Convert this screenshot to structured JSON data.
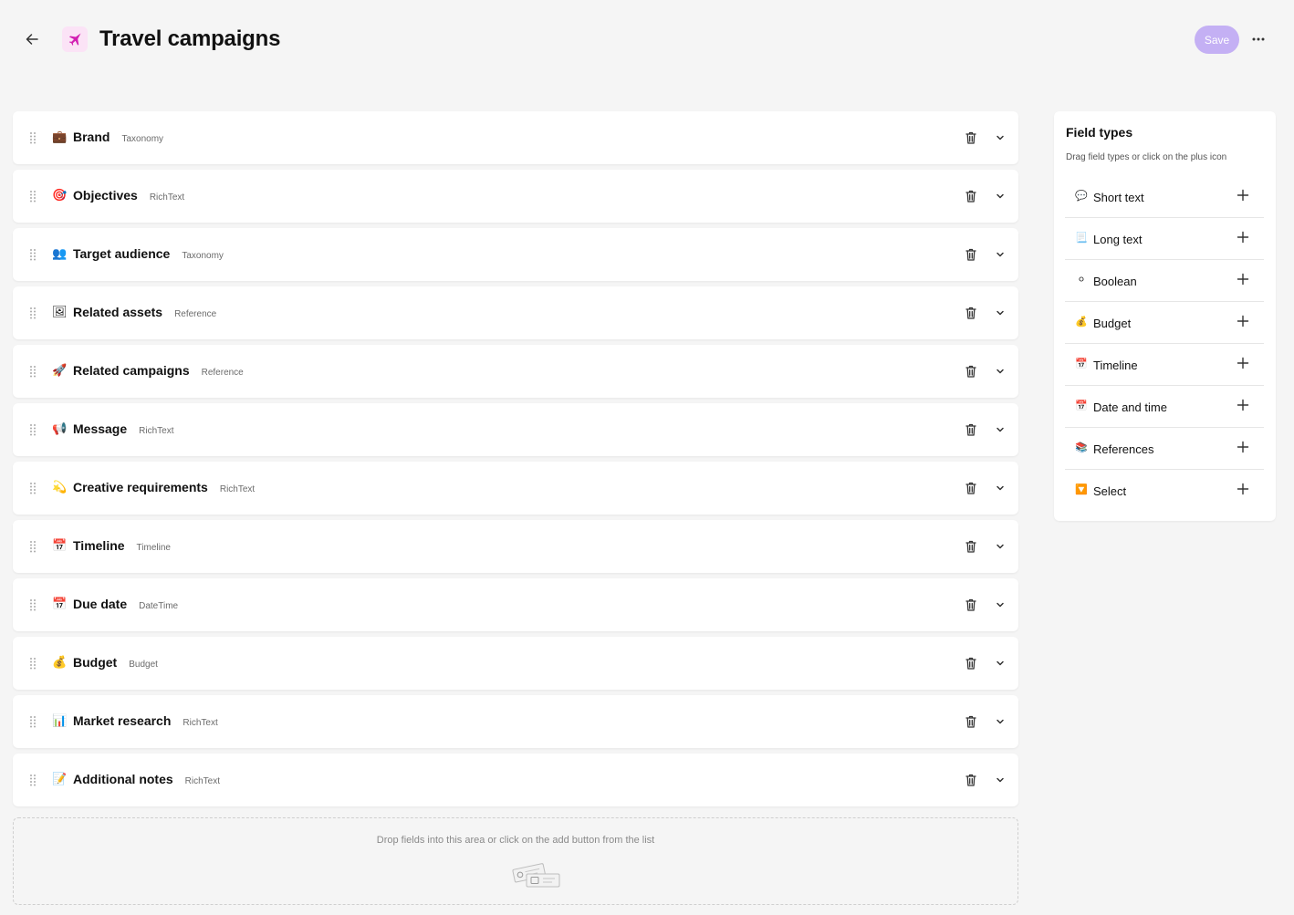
{
  "header": {
    "title": "Travel campaigns",
    "save_label": "Save",
    "back_icon": "arrow-left-icon",
    "app_icon": "airplane-icon",
    "more_icon": "more-horizontal-icon",
    "accent_color": "#c4b0f4",
    "app_icon_color": "#d21fb2"
  },
  "fields": [
    {
      "name": "Brand",
      "type": "Taxonomy",
      "icon": "briefcase-icon",
      "glyph": "💼"
    },
    {
      "name": "Objectives",
      "type": "RichText",
      "icon": "target-icon",
      "glyph": "🎯"
    },
    {
      "name": "Target audience",
      "type": "Taxonomy",
      "icon": "people-icon",
      "glyph": "👥"
    },
    {
      "name": "Related assets",
      "type": "Reference",
      "icon": "picture-icon",
      "glyph": "🖼"
    },
    {
      "name": "Related campaigns",
      "type": "Reference",
      "icon": "rocket-icon",
      "glyph": "🚀"
    },
    {
      "name": "Message",
      "type": "RichText",
      "icon": "megaphone-icon",
      "glyph": "📢"
    },
    {
      "name": "Creative requirements",
      "type": "RichText",
      "icon": "sparkle-icon",
      "glyph": "💫"
    },
    {
      "name": "Timeline",
      "type": "Timeline",
      "icon": "calendar-icon",
      "glyph": "📅"
    },
    {
      "name": "Due date",
      "type": "DateTime",
      "icon": "calendar-icon",
      "glyph": "📅"
    },
    {
      "name": "Budget",
      "type": "Budget",
      "icon": "money-bag-icon",
      "glyph": "💰"
    },
    {
      "name": "Market research",
      "type": "RichText",
      "icon": "bar-chart-icon",
      "glyph": "📊"
    },
    {
      "name": "Additional notes",
      "type": "RichText",
      "icon": "memo-icon",
      "glyph": "📝"
    }
  ],
  "drop_zone": {
    "text": "Drop fields into this area or click on the add button from the list"
  },
  "panel": {
    "title": "Field types",
    "subtitle": "Drag field types or click on the plus icon",
    "types": [
      {
        "label": "Short text",
        "icon": "speech-bubble-icon",
        "glyph": "💬"
      },
      {
        "label": "Long text",
        "icon": "page-icon",
        "glyph": "📃"
      },
      {
        "label": "Boolean",
        "icon": "circle-icon",
        "glyph": "⚪"
      },
      {
        "label": "Budget",
        "icon": "money-bag-icon",
        "glyph": "💰"
      },
      {
        "label": "Timeline",
        "icon": "calendar-icon",
        "glyph": "📅"
      },
      {
        "label": "Date and time",
        "icon": "calendar-icon",
        "glyph": "📅"
      },
      {
        "label": "References",
        "icon": "books-icon",
        "glyph": "📚"
      },
      {
        "label": "Select",
        "icon": "dropdown-icon",
        "glyph": "🔽"
      }
    ]
  }
}
